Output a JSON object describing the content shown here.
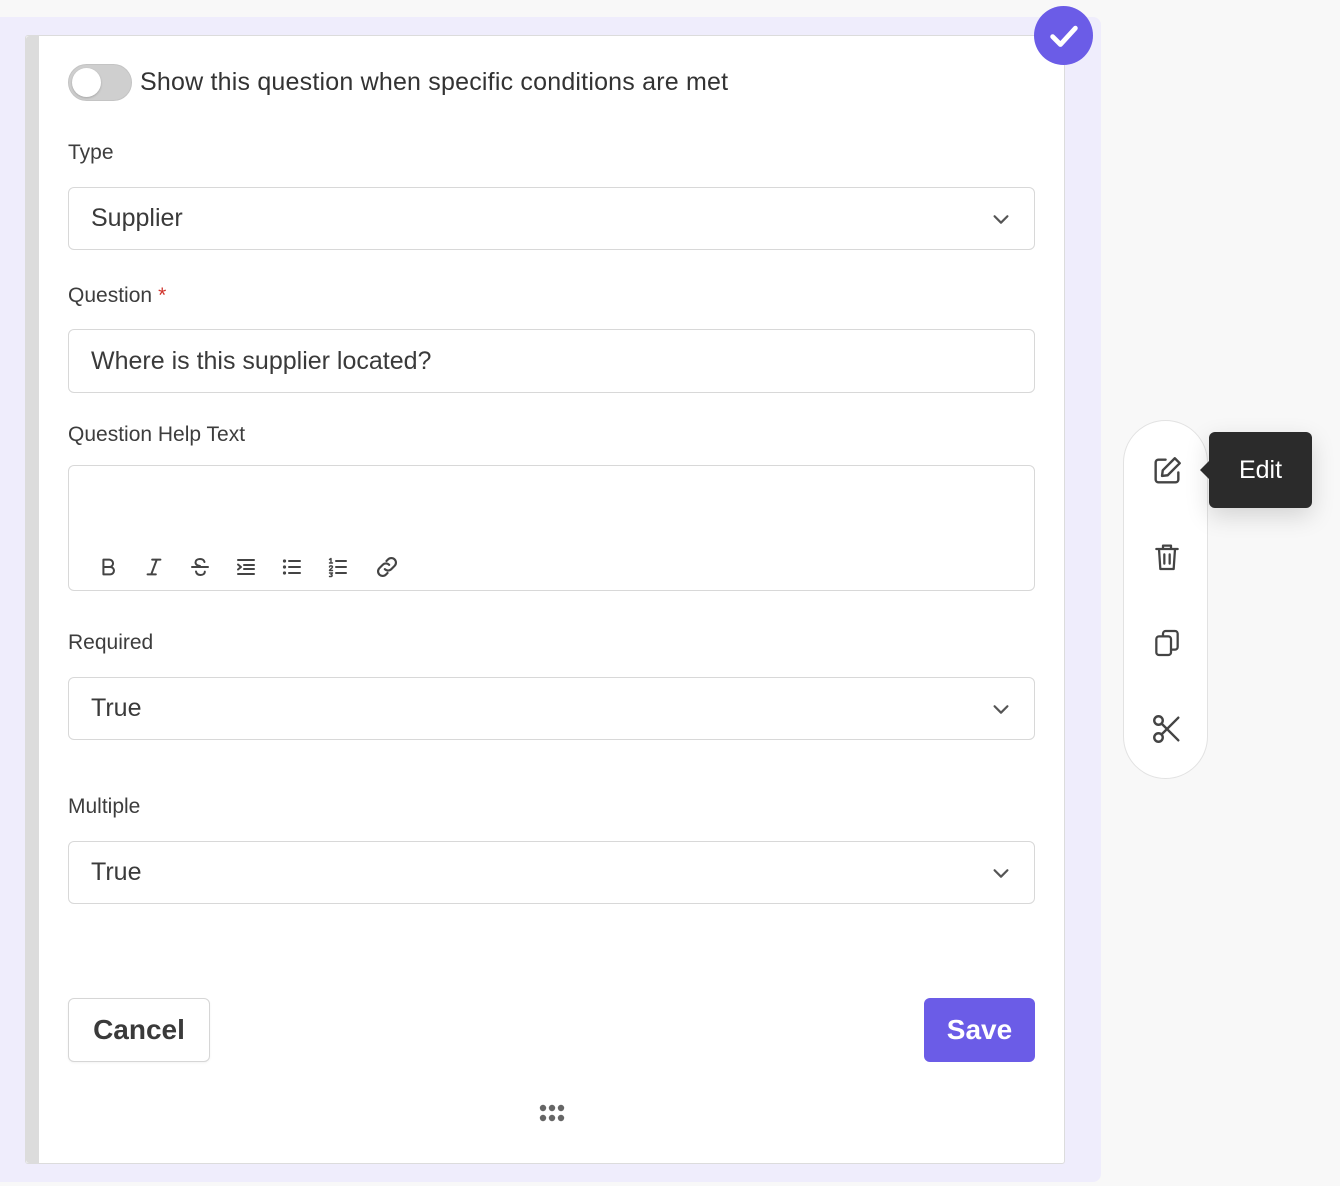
{
  "condition_toggle": {
    "label": "Show this question when specific conditions are met"
  },
  "type_field": {
    "label": "Type",
    "value": "Supplier"
  },
  "question_field": {
    "label": "Question",
    "required_marker": "*",
    "value": "Where is this supplier located?"
  },
  "help_text_field": {
    "label": "Question Help Text",
    "value": "",
    "toolbar": [
      "bold-icon",
      "italic-icon",
      "strikethrough-icon",
      "indent-icon",
      "bullet-list-icon",
      "numbered-list-icon",
      "link-icon"
    ]
  },
  "required_field": {
    "label": "Required",
    "value": "True"
  },
  "multiple_field": {
    "label": "Multiple",
    "value": "True"
  },
  "actions": {
    "cancel_label": "Cancel",
    "save_label": "Save"
  },
  "side_toolbar": {
    "items": [
      "edit-icon",
      "trash-icon",
      "copy-icon",
      "scissors-icon"
    ],
    "tooltip": "Edit"
  },
  "colors": {
    "accent": "#6b5ce7",
    "required": "#d0342c",
    "outer_background": "#efedfc",
    "tooltip_background": "#2b2b2b"
  }
}
